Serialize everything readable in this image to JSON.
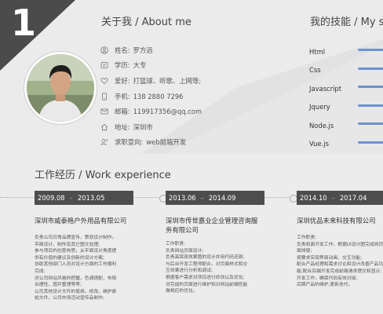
{
  "section_number": "1",
  "about": {
    "title": "关于我 / About me",
    "items": [
      {
        "icon": "user-icon",
        "label": "姓名:",
        "value": "罗方远"
      },
      {
        "icon": "education-icon",
        "label": "学历:",
        "value": "大专"
      },
      {
        "icon": "heart-icon",
        "label": "爱好:",
        "value": "打篮球、听歌、上网等;"
      },
      {
        "icon": "phone-icon",
        "label": "手机:",
        "value": "138 2880 7296"
      },
      {
        "icon": "mail-icon",
        "label": "邮箱:",
        "value": "119917356@qq.com"
      },
      {
        "icon": "home-icon",
        "label": "地址:",
        "value": "深圳市"
      },
      {
        "icon": "job-icon",
        "label": "求职意向:",
        "value": "web前端开发"
      }
    ]
  },
  "skills": {
    "title": "我的技能 / My s",
    "items": [
      {
        "name": "Html",
        "level": 0.9
      },
      {
        "name": "Css",
        "level": 0.9
      },
      {
        "name": "Javascript",
        "level": 0.9
      },
      {
        "name": "Jquery",
        "level": 0.9
      },
      {
        "name": "Node.js",
        "level": 0.9
      },
      {
        "name": "Vue.js",
        "level": 0.9
      }
    ]
  },
  "work": {
    "title": "工作经历 / Work experience",
    "jobs": [
      {
        "start": "2009.08",
        "end": "2013.05",
        "company": "深圳市威泰格户外用品有限公司",
        "lines": [
          "负责公司日常品牌宣传、策划设计制作。",
          "平面设计、制作及其它图文处理;",
          "参与项目的创意构思，从平面设计角度提",
          "供有价值的建议及创新的设计方案;",
          "协助其他部门人员对设计方面的工作顺利",
          "完成;",
          "对公司网站风格的把握，色调搭配，布局",
          "合理性，图片整理等等;",
          "公司其他设计文件的使用，修改、维护原",
          "始文件，公司市场活动宣传品制作;"
        ]
      },
      {
        "start": "2013.06",
        "end": "2014.09",
        "company": "深圳市传世嘉业企业管理咨询服务有限公司",
        "lines": [
          "工作职责:",
          "负责网站页面设计;",
          "负责高保真效果图的设计并用代码还原;",
          "与后台开发工程师配合，对页面样式和交",
          "互效果进行分析和调试;",
          "根据客户需求对项目进行修改以及优化;",
          "对完成的页面进行维护和对网站前端性能",
          "做相应的优化。"
        ]
      },
      {
        "start": "2014.10",
        "end": "2017.04",
        "company": "深圳优品未来科技有限公司",
        "lines": [
          "工作职责:",
          "负责和面开发工作，根据UI设计图完成网页",
          "面排版;",
          "按要求实现界面动画、交互功能;",
          "配合产品经理和需求讨论和设计改善产品功",
          "能;配合后端开发完成前端请求提交和显示;",
          "开发工作，确保代码有效对接;",
          "后期产品的维护,更新迭代。"
        ]
      }
    ]
  },
  "colors": {
    "accent": "#6c92d1",
    "dark": "#4d4d4d"
  }
}
